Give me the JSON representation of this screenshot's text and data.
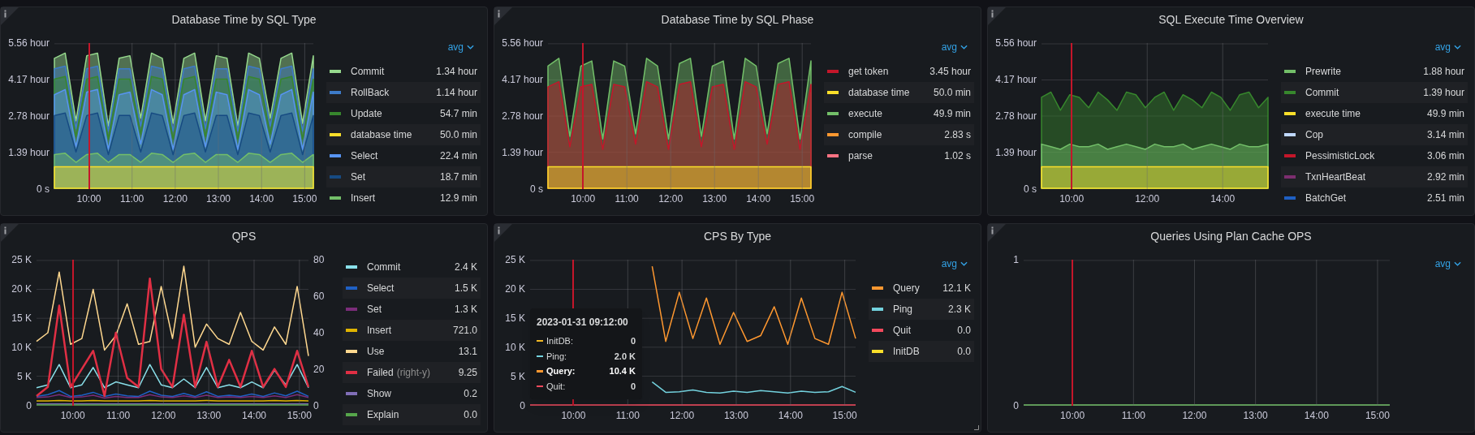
{
  "panels": [
    {
      "title": "Database Time by SQL Type",
      "chart_data": {
        "type": "area",
        "grid": true,
        "legend": true,
        "ref_lines": [
          {
            "axis": "x",
            "value": 10,
            "color": "#c4162a"
          }
        ],
        "x": [
          9.2,
          9.45,
          9.7,
          9.95,
          10.2,
          10.45,
          10.7,
          10.95,
          11.2,
          11.45,
          11.7,
          11.95,
          12.2,
          12.45,
          12.7,
          12.95,
          13.2,
          13.45,
          13.7,
          13.95,
          14.2,
          14.45,
          14.7,
          14.95,
          15.2
        ],
        "xlim": [
          9.2,
          15.2
        ],
        "ylim": [
          0,
          5.56
        ],
        "xticks": [
          {
            "value": 10,
            "label": "10:00"
          },
          {
            "value": 11,
            "label": "11:00"
          },
          {
            "value": 12,
            "label": "12:00"
          },
          {
            "value": 13,
            "label": "13:00"
          },
          {
            "value": 14,
            "label": "14:00"
          },
          {
            "value": 15,
            "label": "15:00"
          }
        ],
        "yticks": [
          {
            "value": 5.56,
            "label": "5.56 hour"
          },
          {
            "value": 4.17,
            "label": "4.17 hour"
          },
          {
            "value": 2.78,
            "label": "2.78 hour"
          },
          {
            "value": 1.39,
            "label": "1.39 hour"
          },
          {
            "value": 0,
            "label": "0 s"
          }
        ],
        "series": [
          {
            "name": "Commit",
            "color": "#96d98d",
            "values": [
              5.0,
              5.2,
              2.6,
              5.1,
              5.2,
              2.4,
              5.0,
              5.1,
              2.7,
              5.2,
              5.0,
              2.5,
              5.0,
              5.2,
              2.6,
              5.1,
              5.0,
              2.4,
              5.2,
              5.0,
              2.7,
              5.0,
              5.2,
              2.5,
              5.1
            ]
          },
          {
            "name": "RollBack",
            "color": "#3d7bc9",
            "values": [
              4.6,
              4.7,
              2.3,
              4.6,
              4.7,
              2.2,
              4.6,
              4.6,
              2.4,
              4.7,
              4.6,
              2.2,
              4.6,
              4.7,
              2.3,
              4.6,
              4.6,
              2.2,
              4.7,
              4.6,
              2.4,
              4.6,
              4.7,
              2.2,
              4.6
            ]
          },
          {
            "name": "Update",
            "color": "#37872d",
            "values": [
              4.2,
              4.3,
              2.0,
              4.2,
              4.3,
              1.9,
              4.2,
              4.2,
              2.1,
              4.3,
              4.2,
              1.9,
              4.2,
              4.3,
              2.0,
              4.2,
              4.2,
              1.9,
              4.3,
              4.2,
              2.1,
              4.2,
              4.3,
              1.9,
              4.2
            ]
          },
          {
            "name": "database time",
            "color": "#fade2a",
            "values": [
              0.83,
              0.83,
              0.83,
              0.83,
              0.83,
              0.83,
              0.83,
              0.83,
              0.83,
              0.83,
              0.83,
              0.83,
              0.83,
              0.83,
              0.83,
              0.83,
              0.83,
              0.83,
              0.83,
              0.83,
              0.83,
              0.83,
              0.83,
              0.83,
              0.83
            ]
          },
          {
            "name": "Select",
            "color": "#5794f2",
            "values": [
              3.6,
              3.8,
              1.6,
              3.7,
              3.8,
              1.5,
              3.6,
              3.7,
              1.7,
              3.8,
              3.6,
              1.5,
              3.6,
              3.8,
              1.6,
              3.7,
              3.6,
              1.5,
              3.8,
              3.6,
              1.7,
              3.6,
              3.8,
              1.5,
              3.7
            ]
          },
          {
            "name": "Set",
            "color": "#164a82",
            "values": [
              2.8,
              2.9,
              1.4,
              2.8,
              2.9,
              1.3,
              2.8,
              2.8,
              1.4,
              2.9,
              2.8,
              1.3,
              2.8,
              2.9,
              1.4,
              2.8,
              2.8,
              1.3,
              2.9,
              2.8,
              1.4,
              2.8,
              2.9,
              1.3,
              2.8
            ]
          },
          {
            "name": "Insert",
            "color": "#73bf69",
            "values": [
              1.3,
              1.35,
              1.0,
              1.3,
              1.35,
              1.0,
              1.3,
              1.3,
              1.0,
              1.35,
              1.3,
              1.0,
              1.3,
              1.35,
              1.0,
              1.3,
              1.3,
              1.0,
              1.35,
              1.3,
              1.0,
              1.3,
              1.35,
              1.0,
              1.3
            ]
          }
        ]
      },
      "legend": {
        "sort": "avg",
        "items": [
          {
            "value": "1.34 hour"
          },
          {
            "value": "1.14 hour"
          },
          {
            "value": "54.7 min"
          },
          {
            "value": "50.0 min"
          },
          {
            "value": "22.4 min"
          },
          {
            "value": "18.7 min"
          },
          {
            "value": "12.9 min"
          }
        ]
      }
    },
    {
      "title": "Database Time by SQL Phase",
      "chart_data": {
        "type": "area",
        "grid": true,
        "legend": true,
        "ref_lines": [
          {
            "axis": "x",
            "value": 10,
            "color": "#c4162a"
          }
        ],
        "x": [
          9.2,
          9.45,
          9.7,
          9.95,
          10.2,
          10.45,
          10.7,
          10.95,
          11.2,
          11.45,
          11.7,
          11.95,
          12.2,
          12.45,
          12.7,
          12.95,
          13.2,
          13.45,
          13.7,
          13.95,
          14.2,
          14.45,
          14.7,
          14.95,
          15.2
        ],
        "xlim": [
          9.2,
          15.2
        ],
        "ylim": [
          0,
          5.56
        ],
        "xticks": [
          {
            "value": 10,
            "label": "10:00"
          },
          {
            "value": 11,
            "label": "11:00"
          },
          {
            "value": 12,
            "label": "12:00"
          },
          {
            "value": 13,
            "label": "13:00"
          },
          {
            "value": 14,
            "label": "14:00"
          },
          {
            "value": 15,
            "label": "15:00"
          }
        ],
        "yticks": [
          {
            "value": 5.56,
            "label": "5.56 hour"
          },
          {
            "value": 4.17,
            "label": "4.17 hour"
          },
          {
            "value": 2.78,
            "label": "2.78 hour"
          },
          {
            "value": 1.39,
            "label": "1.39 hour"
          },
          {
            "value": 0,
            "label": "0 s"
          }
        ],
        "series": [
          {
            "name": "get token",
            "color": "#c4162a",
            "values": [
              3.9,
              4.1,
              1.6,
              3.9,
              4.0,
              1.5,
              4.0,
              3.9,
              1.7,
              4.1,
              3.9,
              1.5,
              4.0,
              4.1,
              1.6,
              3.9,
              4.0,
              1.5,
              4.1,
              3.9,
              1.7,
              4.0,
              4.1,
              1.5,
              4.0
            ]
          },
          {
            "name": "database time",
            "color": "#fade2a",
            "values": [
              0.83,
              0.83,
              0.83,
              0.83,
              0.83,
              0.83,
              0.83,
              0.83,
              0.83,
              0.83,
              0.83,
              0.83,
              0.83,
              0.83,
              0.83,
              0.83,
              0.83,
              0.83,
              0.83,
              0.83,
              0.83,
              0.83,
              0.83,
              0.83,
              0.83
            ]
          },
          {
            "name": "execute",
            "color": "#73bf69",
            "values": [
              4.7,
              5.0,
              2.0,
              4.7,
              4.9,
              1.9,
              4.9,
              4.7,
              2.1,
              5.0,
              4.7,
              1.9,
              4.8,
              5.0,
              2.0,
              4.7,
              4.9,
              1.9,
              5.0,
              4.7,
              2.1,
              4.8,
              5.0,
              1.9,
              4.9
            ]
          },
          {
            "name": "compile",
            "color": "#ff9830",
            "values": [
              null,
              null,
              null,
              null,
              null,
              null,
              null,
              null,
              null,
              null,
              null,
              null,
              null,
              null,
              null,
              null,
              null,
              null,
              null,
              null,
              null,
              null,
              null,
              null,
              null
            ]
          },
          {
            "name": "parse",
            "color": "#ff7383",
            "values": [
              null,
              null,
              null,
              null,
              null,
              null,
              null,
              null,
              null,
              null,
              null,
              null,
              null,
              null,
              null,
              null,
              null,
              null,
              null,
              null,
              null,
              null,
              null,
              null,
              null
            ]
          }
        ]
      },
      "legend": {
        "sort": "avg",
        "items": [
          {
            "value": "3.45 hour"
          },
          {
            "value": "50.0 min"
          },
          {
            "value": "49.9 min"
          },
          {
            "value": "2.83 s"
          },
          {
            "value": "1.02 s"
          }
        ]
      }
    },
    {
      "title": "SQL Execute Time Overview",
      "chart_data": {
        "type": "area",
        "grid": true,
        "legend": true,
        "ref_lines": [
          {
            "axis": "x",
            "value": 10,
            "color": "#c4162a"
          }
        ],
        "x": [
          9.2,
          9.45,
          9.7,
          9.95,
          10.2,
          10.45,
          10.7,
          10.95,
          11.2,
          11.45,
          11.7,
          11.95,
          12.2,
          12.45,
          12.7,
          12.95,
          13.2,
          13.45,
          13.7,
          13.95,
          14.2,
          14.45,
          14.7,
          14.95,
          15.2
        ],
        "xlim": [
          9.2,
          15.2
        ],
        "ylim": [
          0,
          5.56
        ],
        "xticks": [
          {
            "value": 10,
            "label": "10:00"
          },
          {
            "value": 12,
            "label": "12:00"
          },
          {
            "value": 14,
            "label": "14:00"
          }
        ],
        "yticks": [
          {
            "value": 5.56,
            "label": "5.56 hour"
          },
          {
            "value": 4.17,
            "label": "4.17 hour"
          },
          {
            "value": 2.78,
            "label": "2.78 hour"
          },
          {
            "value": 1.39,
            "label": "1.39 hour"
          },
          {
            "value": 0,
            "label": "0 s"
          }
        ],
        "series": [
          {
            "name": "Prewrite",
            "color": "#73bf69",
            "values": [
              1.7,
              1.6,
              1.5,
              1.7,
              1.6,
              1.6,
              1.7,
              1.5,
              1.6,
              1.7,
              1.6,
              1.5,
              1.7,
              1.6,
              1.6,
              1.7,
              1.5,
              1.6,
              1.7,
              1.6,
              1.5,
              1.7,
              1.6,
              1.6,
              1.7
            ]
          },
          {
            "name": "Commit",
            "color": "#37872d",
            "values": [
              3.5,
              3.7,
              3.0,
              3.6,
              3.5,
              3.1,
              3.7,
              3.4,
              3.0,
              3.7,
              3.6,
              3.1,
              3.5,
              3.7,
              3.0,
              3.6,
              3.4,
              3.1,
              3.7,
              3.5,
              3.0,
              3.6,
              3.7,
              3.1,
              3.5
            ]
          },
          {
            "name": "execute time",
            "color": "#fade2a",
            "values": [
              0.83,
              0.83,
              0.83,
              0.83,
              0.83,
              0.83,
              0.83,
              0.83,
              0.83,
              0.83,
              0.83,
              0.83,
              0.83,
              0.83,
              0.83,
              0.83,
              0.83,
              0.83,
              0.83,
              0.83,
              0.83,
              0.83,
              0.83,
              0.83,
              0.83
            ]
          },
          {
            "name": "Cop",
            "color": "#c0d8ff",
            "values": [
              null,
              null,
              null,
              null,
              null,
              null,
              null,
              null,
              null,
              null,
              null,
              null,
              null,
              null,
              null,
              null,
              null,
              null,
              null,
              null,
              null,
              null,
              null,
              null,
              null
            ]
          },
          {
            "name": "PessimisticLock",
            "color": "#c4162a",
            "values": [
              null,
              null,
              null,
              null,
              null,
              null,
              null,
              null,
              null,
              null,
              null,
              null,
              null,
              null,
              null,
              null,
              null,
              null,
              null,
              null,
              null,
              null,
              null,
              null,
              null
            ]
          },
          {
            "name": "TxnHeartBeat",
            "color": "#7c2e6f",
            "values": [
              null,
              null,
              null,
              null,
              null,
              null,
              null,
              null,
              null,
              null,
              null,
              null,
              null,
              null,
              null,
              null,
              null,
              null,
              null,
              null,
              null,
              null,
              null,
              null,
              null
            ]
          },
          {
            "name": "BatchGet",
            "color": "#1f60c4",
            "values": [
              null,
              null,
              null,
              null,
              null,
              null,
              null,
              null,
              null,
              null,
              null,
              null,
              null,
              null,
              null,
              null,
              null,
              null,
              null,
              null,
              null,
              null,
              null,
              null,
              null
            ]
          }
        ]
      },
      "legend": {
        "sort": "avg",
        "items": [
          {
            "value": "1.88 hour"
          },
          {
            "value": "1.39 hour"
          },
          {
            "value": "49.9 min"
          },
          {
            "value": "3.14 min"
          },
          {
            "value": "3.06 min"
          },
          {
            "value": "2.92 min"
          },
          {
            "value": "2.51 min"
          }
        ]
      }
    },
    {
      "title": "QPS",
      "chart_data": {
        "type": "line",
        "grid": true,
        "legend": true,
        "ref_lines": [
          {
            "axis": "x",
            "value": 10,
            "color": "#c4162a"
          }
        ],
        "x": [
          9.2,
          9.45,
          9.7,
          9.95,
          10.2,
          10.45,
          10.7,
          10.95,
          11.2,
          11.45,
          11.7,
          11.95,
          12.2,
          12.45,
          12.7,
          12.95,
          13.2,
          13.45,
          13.7,
          13.95,
          14.2,
          14.45,
          14.7,
          14.95,
          15.2
        ],
        "xlim": [
          9.2,
          15.2
        ],
        "ylim": [
          0,
          25000
        ],
        "y2lim": [
          0,
          80
        ],
        "xticks": [
          {
            "value": 10,
            "label": "10:00"
          },
          {
            "value": 11,
            "label": "11:00"
          },
          {
            "value": 12,
            "label": "12:00"
          },
          {
            "value": 13,
            "label": "13:00"
          },
          {
            "value": 14,
            "label": "14:00"
          },
          {
            "value": 15,
            "label": "15:00"
          }
        ],
        "yticks": [
          {
            "value": 25000,
            "label": "25 K"
          },
          {
            "value": 20000,
            "label": "20 K"
          },
          {
            "value": 15000,
            "label": "15 K"
          },
          {
            "value": 10000,
            "label": "10 K"
          },
          {
            "value": 5000,
            "label": "5 K"
          },
          {
            "value": 0,
            "label": "0"
          }
        ],
        "y2ticks": [
          {
            "value": 80,
            "label": "80"
          },
          {
            "value": 60,
            "label": "60"
          },
          {
            "value": 40,
            "label": "40"
          },
          {
            "value": 20,
            "label": "20"
          },
          {
            "value": 0,
            "label": "0"
          }
        ],
        "series": [
          {
            "name": "Commit",
            "color": "#8ae0ea",
            "values": [
              3000,
              3500,
              7000,
              3000,
              3500,
              6500,
              3000,
              4000,
              3500,
              3000,
              7000,
              3500,
              3000,
              4500,
              3000,
              6500,
              3000,
              3500,
              3000,
              4000,
              3000,
              6000,
              3500,
              7000,
              3000
            ]
          },
          {
            "name": "Select",
            "color": "#1f60c4",
            "values": [
              1500,
              1800,
              2500,
              1500,
              1700,
              2200,
              1500,
              1900,
              1600,
              1500,
              2400,
              1700,
              1500,
              2000,
              1500,
              2300,
              1500,
              1700,
              1500,
              1900,
              1500,
              2100,
              1600,
              2400,
              1500
            ]
          },
          {
            "name": "Set",
            "color": "#7b2d7a",
            "values": [
              1300,
              1400,
              1800,
              1300,
              1400,
              1700,
              1200,
              1500,
              1300,
              1300,
              1800,
              1400,
              1300,
              1600,
              1300,
              1700,
              1300,
              1400,
              1300,
              1500,
              1300,
              1600,
              1300,
              1800,
              1300
            ]
          },
          {
            "name": "Insert",
            "color": "#e0b400",
            "values": [
              700,
              700,
              800,
              700,
              700,
              800,
              700,
              700,
              700,
              700,
              800,
              700,
              700,
              700,
              700,
              800,
              700,
              700,
              700,
              700,
              700,
              800,
              700,
              800,
              700
            ]
          },
          {
            "name": "Use",
            "color": "#ffd88f",
            "values": [
              11000,
              12500,
              23000,
              10500,
              11500,
              20000,
              9500,
              12000,
              17500,
              10500,
              11000,
              20500,
              11500,
              24000,
              10000,
              14000,
              11500,
              10500,
              16000,
              11000,
              9500,
              13500,
              10500,
              20500,
              8500
            ]
          },
          {
            "name": "Failed",
            "axis": "y2",
            "color": "#e02f44",
            "values": [
              5,
              10,
              55,
              10,
              20,
              30,
              5,
              40,
              15,
              10,
              70,
              20,
              10,
              50,
              10,
              35,
              10,
              25,
              10,
              30,
              10,
              20,
              10,
              30,
              10
            ]
          },
          {
            "name": "Show",
            "color": "#806eb7",
            "values": [
              200,
              200,
              200,
              200,
              200,
              200,
              200,
              200,
              200,
              200,
              200,
              200,
              200,
              200,
              200,
              200,
              200,
              200,
              200,
              200,
              200,
              200,
              200,
              200,
              200
            ]
          },
          {
            "name": "Explain",
            "color": "#56a64b",
            "values": [
              0,
              0,
              0,
              0,
              0,
              0,
              0,
              0,
              0,
              0,
              0,
              0,
              0,
              0,
              0,
              0,
              0,
              0,
              0,
              0,
              0,
              0,
              0,
              0,
              0
            ]
          }
        ]
      },
      "legend": {
        "items": [
          {
            "value": "2.4 K"
          },
          {
            "value": "1.5 K"
          },
          {
            "value": "1.3 K"
          },
          {
            "value": "721.0"
          },
          {
            "value": "13.1"
          },
          {
            "value": "9.25",
            "note": "(right-y)"
          },
          {
            "value": "0.2"
          },
          {
            "value": "0.0"
          }
        ]
      }
    },
    {
      "title": "CPS By Type",
      "resize_handle": true,
      "chart_data": {
        "type": "line",
        "grid": true,
        "legend": true,
        "ref_lines": [
          {
            "axis": "x",
            "value": 10,
            "color": "#c4162a"
          }
        ],
        "x": [
          9.2,
          9.45,
          9.7,
          9.95,
          10.2,
          10.45,
          10.7,
          10.95,
          11.2,
          11.45,
          11.7,
          11.95,
          12.2,
          12.45,
          12.7,
          12.95,
          13.2,
          13.45,
          13.7,
          13.95,
          14.2,
          14.45,
          14.7,
          14.95,
          15.2
        ],
        "xlim": [
          9.2,
          15.2
        ],
        "ylim": [
          0,
          25000
        ],
        "xticks": [
          {
            "value": 10,
            "label": "10:00"
          },
          {
            "value": 11,
            "label": "11:00"
          },
          {
            "value": 12,
            "label": "12:00"
          },
          {
            "value": 13,
            "label": "13:00"
          },
          {
            "value": 14,
            "label": "14:00"
          },
          {
            "value": 15,
            "label": "15:00"
          }
        ],
        "yticks": [
          {
            "value": 25000,
            "label": "25 K"
          },
          {
            "value": 20000,
            "label": "20 K"
          },
          {
            "value": 15000,
            "label": "15 K"
          },
          {
            "value": 10000,
            "label": "10 K"
          },
          {
            "value": 5000,
            "label": "5 K"
          },
          {
            "value": 0,
            "label": "0"
          }
        ],
        "series": [
          {
            "name": "Query",
            "color": "#ff9830",
            "values": [
              null,
              null,
              null,
              null,
              null,
              null,
              null,
              null,
              null,
              24000,
              11000,
              19500,
              11500,
              18500,
              10500,
              16000,
              11000,
              12000,
              17000,
              10500,
              18500,
              11500,
              10500,
              19500,
              11500
            ]
          },
          {
            "name": "Ping",
            "color": "#73d2de",
            "values": [
              null,
              null,
              null,
              null,
              null,
              null,
              null,
              null,
              null,
              4000,
              2200,
              2300,
              2600,
              2200,
              2100,
              2400,
              2200,
              2500,
              2300,
              2100,
              2400,
              2200,
              2300,
              3200,
              2200
            ]
          },
          {
            "name": "Quit",
            "color": "#f2495c",
            "values": [
              0,
              0,
              0,
              0,
              0,
              0,
              0,
              0,
              0,
              0,
              0,
              0,
              0,
              0,
              0,
              0,
              0,
              0,
              0,
              0,
              0,
              0,
              0,
              0,
              0
            ]
          },
          {
            "name": "InitDB",
            "color": "#fade2a",
            "values": [
              null,
              null,
              null,
              null,
              null,
              null,
              null,
              null,
              null,
              null,
              null,
              null,
              null,
              null,
              null,
              null,
              null,
              null,
              null,
              null,
              null,
              null,
              null,
              null,
              null
            ]
          }
        ]
      },
      "legend": {
        "sort": "avg",
        "items": [
          {
            "value": "12.1 K"
          },
          {
            "value": "2.3 K"
          },
          {
            "value": "0.0"
          },
          {
            "value": "0.0"
          }
        ]
      },
      "tooltip": {
        "time": "2023-01-31 09:12:00",
        "rows": [
          {
            "name": "InitDB:",
            "value": "0",
            "color": "#f2b824",
            "selected": false
          },
          {
            "name": "Ping:",
            "value": "2.0 K",
            "color": "#73d2de",
            "selected": false
          },
          {
            "name": "Query:",
            "value": "10.4 K",
            "color": "#ff9830",
            "selected": true
          },
          {
            "name": "Quit:",
            "value": "0",
            "color": "#f2495c",
            "selected": false
          }
        ]
      }
    },
    {
      "title": "Queries Using Plan Cache OPS",
      "chart_data": {
        "type": "line",
        "grid": true,
        "ref_lines": [
          {
            "axis": "x",
            "value": 10,
            "color": "#c4162a"
          }
        ],
        "x": [
          9.2,
          9.45,
          9.7,
          9.95,
          10.2,
          10.45,
          10.7,
          10.95,
          11.2,
          11.45,
          11.7,
          11.95,
          12.2,
          12.45,
          12.7,
          12.95,
          13.2,
          13.45,
          13.7,
          13.95,
          14.2,
          14.45,
          14.7,
          14.95,
          15.2
        ],
        "xlim": [
          9.2,
          15.2
        ],
        "ylim": [
          0,
          1
        ],
        "xticks": [
          {
            "value": 10,
            "label": "10:00"
          },
          {
            "value": 11,
            "label": "11:00"
          },
          {
            "value": 12,
            "label": "12:00"
          },
          {
            "value": 13,
            "label": "13:00"
          },
          {
            "value": 14,
            "label": "14:00"
          },
          {
            "value": 15,
            "label": "15:00"
          }
        ],
        "yticks": [
          {
            "value": 1,
            "label": "1"
          },
          {
            "value": 0,
            "label": "0"
          }
        ],
        "series": [
          {
            "color": "#73bf69",
            "values": [
              0,
              0,
              0,
              0,
              0,
              0,
              0,
              0,
              0,
              0,
              0,
              0,
              0,
              0,
              0,
              0,
              0,
              0,
              0,
              0,
              0,
              0,
              0,
              0,
              0
            ]
          }
        ]
      },
      "legend": {
        "sort": "avg"
      }
    }
  ]
}
